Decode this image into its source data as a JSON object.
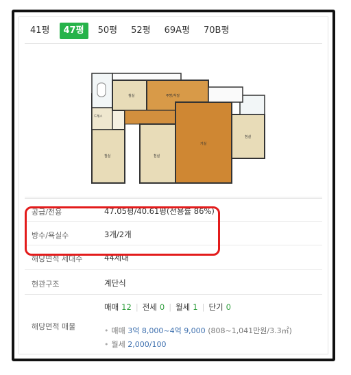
{
  "tabs": [
    {
      "label": "41평",
      "active": false
    },
    {
      "label": "47평",
      "active": true
    },
    {
      "label": "50평",
      "active": false
    },
    {
      "label": "52평",
      "active": false
    },
    {
      "label": "69A평",
      "active": false
    },
    {
      "label": "70B평",
      "active": false
    }
  ],
  "colors": {
    "tab_active": "#26b34a",
    "highlight": "#e31b1b",
    "count_green": "#2e9e3c",
    "price_blue": "#3d6fae"
  },
  "info": {
    "supply": {
      "label": "공급/전용",
      "value": "47.05평/40.61평(전용률 86%)"
    },
    "rooms": {
      "label": "방수/욕실수",
      "value": "3개/2개"
    },
    "households": {
      "label": "해당면적 세대수",
      "value": "44세대"
    },
    "entrance": {
      "label": "현관구조",
      "value": "계단식"
    },
    "listings": {
      "label": "해당면적 매물",
      "counts": [
        {
          "label": "매매",
          "count": "12"
        },
        {
          "label": "전세",
          "count": "0"
        },
        {
          "label": "월세",
          "count": "1"
        },
        {
          "label": "단기",
          "count": "0"
        }
      ],
      "sale": {
        "prefix": "매매",
        "range": "3억 8,000~4억 9,000",
        "note": "(808~1,041만원/3.3㎡)"
      },
      "rent": {
        "prefix": "월세",
        "value": "2,000/100"
      }
    }
  }
}
